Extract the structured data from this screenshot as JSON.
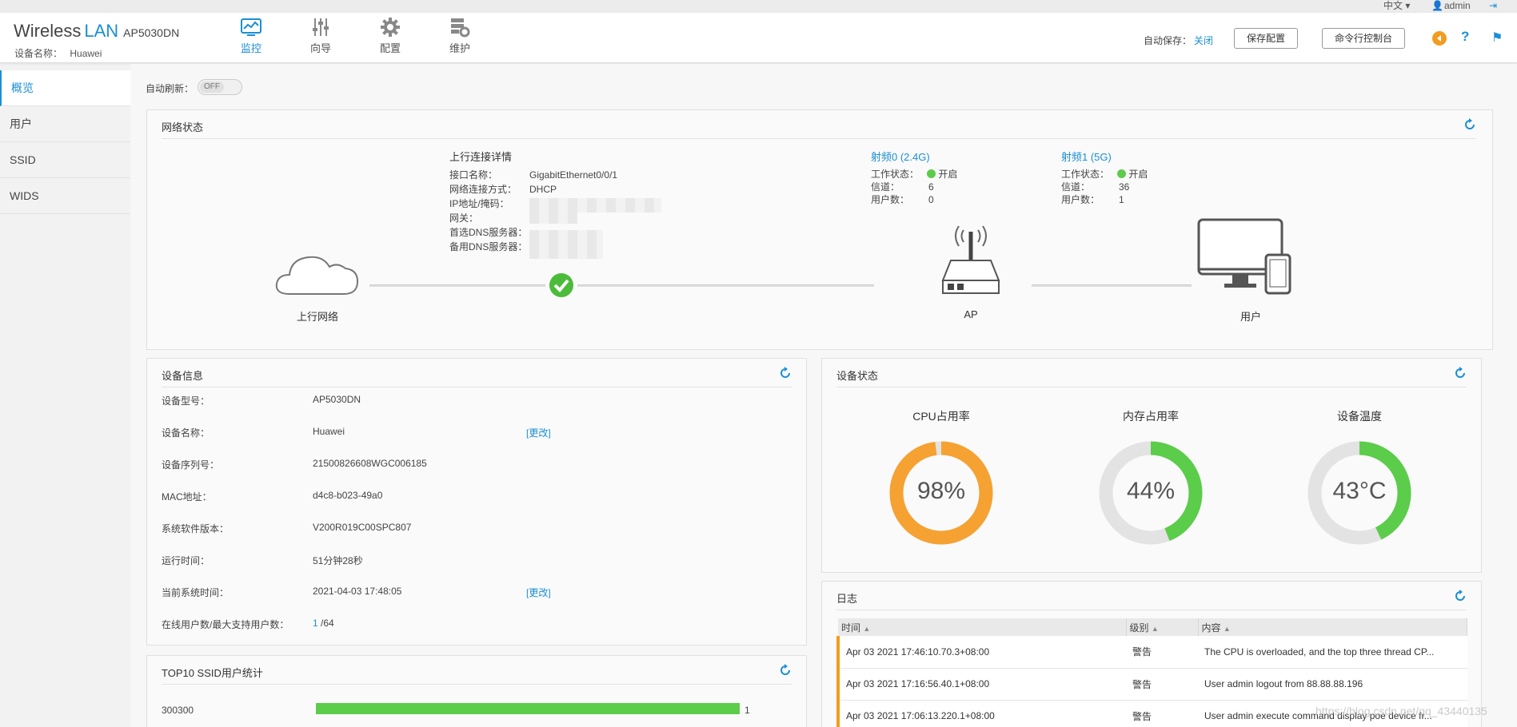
{
  "util": {
    "language": "中文",
    "user": "admin"
  },
  "header": {
    "brand_wireless": "Wireless",
    "brand_lan": "LAN",
    "model": "AP5030DN",
    "device_name_label": "设备名称：",
    "device_name": "Huawei",
    "nav": [
      {
        "label": "监控",
        "icon": "monitor-icon",
        "active": true
      },
      {
        "label": "向导",
        "icon": "sliders-icon"
      },
      {
        "label": "配置",
        "icon": "gear-icon"
      },
      {
        "label": "维护",
        "icon": "maintenance-icon"
      }
    ],
    "autosave_label": "自动保存：",
    "autosave_value": "关闭",
    "save_config": "保存配置",
    "cli_console": "命令行控制台"
  },
  "sidebar": {
    "items": [
      {
        "label": "概览",
        "active": true
      },
      {
        "label": "用户"
      },
      {
        "label": "SSID"
      },
      {
        "label": "WIDS"
      }
    ]
  },
  "auto_refresh": {
    "label": "自动刷新：",
    "state": "OFF"
  },
  "network": {
    "title": "网络状态",
    "uplink_title": "上行连接详情",
    "uplink_rows": [
      {
        "label": "接口名称：",
        "value": "GigabitEthernet0/0/1"
      },
      {
        "label": "网络连接方式：",
        "value": "DHCP"
      },
      {
        "label": "IP地址/掩码：",
        "value": ""
      },
      {
        "label": "网关：",
        "value": ""
      },
      {
        "label": "首选DNS服务器：",
        "value": ""
      },
      {
        "label": "备用DNS服务器：",
        "value": ""
      }
    ],
    "radio0": {
      "title": "射频0 (2.4G)",
      "rows": [
        {
          "label": "工作状态：",
          "value": "开启"
        },
        {
          "label": "信道：",
          "value": "6"
        },
        {
          "label": "用户数：",
          "value": "0"
        }
      ]
    },
    "radio1": {
      "title": "射频1 (5G)",
      "rows": [
        {
          "label": "工作状态：",
          "value": "开启"
        },
        {
          "label": "信道：",
          "value": "36"
        },
        {
          "label": "用户数：",
          "value": "1"
        }
      ]
    },
    "uplink_network": "上行网络",
    "ap": "AP",
    "users": "用户"
  },
  "device_info": {
    "title": "设备信息",
    "rows": [
      {
        "label": "设备型号：",
        "value": "AP5030DN"
      },
      {
        "label": "设备名称：",
        "value": "Huawei",
        "link": "[更改]"
      },
      {
        "label": "设备序列号：",
        "value": "21500826608WGC006185"
      },
      {
        "label": "MAC地址：",
        "value": "d4c8-b023-49a0"
      },
      {
        "label": "系统软件版本：",
        "value": "V200R019C00SPC807"
      },
      {
        "label": "运行时间：",
        "value": "51分钟28秒"
      },
      {
        "label": "当前系统时间：",
        "value": "2021-04-03 17:48:05",
        "link": "[更改]"
      },
      {
        "label": "在线用户数/最大支持用户数：",
        "value": " /64",
        "value_link": "1"
      }
    ]
  },
  "device_status": {
    "title": "设备状态",
    "gauges": [
      {
        "title": "CPU占用率",
        "display": "98%",
        "percent": 98,
        "color": "#f5a233"
      },
      {
        "title": "内存占用率",
        "display": "44%",
        "percent": 44,
        "color": "#5ccc4b"
      },
      {
        "title": "设备温度",
        "display": "43°C",
        "percent": 43,
        "color": "#5ccc4b"
      }
    ]
  },
  "top10": {
    "title": "TOP10 SSID用户统计",
    "rows": [
      {
        "ssid": "300300",
        "count": "1",
        "fraction": 1.0
      }
    ]
  },
  "log": {
    "title": "日志",
    "columns": [
      "时间",
      "级别",
      "内容"
    ],
    "rows": [
      {
        "time": "Apr 03 2021 17:46:10.70.3+08:00",
        "level": "警告",
        "content": "The CPU is overloaded, and the top three thread CP..."
      },
      {
        "time": "Apr 03 2021 17:16:56.40.1+08:00",
        "level": "警告",
        "content": "User admin logout from 88.88.88.196"
      },
      {
        "time": "Apr 03 2021 17:06:13.220.1+08:00",
        "level": "警告",
        "content": "User admin execute command display  poe device fr..."
      }
    ]
  },
  "watermark": "https://blog.csdn.net/qq_43440135"
}
